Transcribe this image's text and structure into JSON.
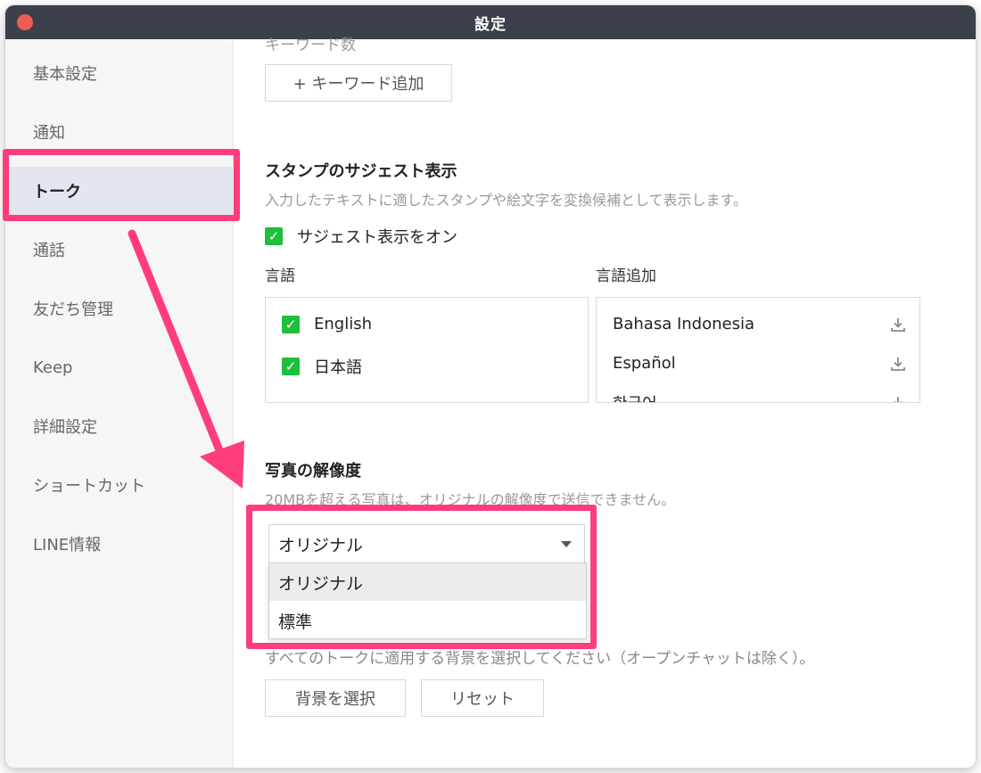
{
  "window": {
    "title": "設定"
  },
  "sidebar": {
    "items": [
      {
        "label": "基本設定"
      },
      {
        "label": "通知"
      },
      {
        "label": "トーク"
      },
      {
        "label": "通話"
      },
      {
        "label": "友だち管理"
      },
      {
        "label": "Keep"
      },
      {
        "label": "詳細設定"
      },
      {
        "label": "ショートカット"
      },
      {
        "label": "LINE情報"
      }
    ],
    "active_index": 2
  },
  "keyword": {
    "count_text_partial": "キーワード数",
    "add_button": "+ キーワード追加"
  },
  "sticker_suggest": {
    "title": "スタンプのサジェスト表示",
    "description": "入力したテキストに適したスタンプや絵文字を変換候補として表示します。",
    "toggle_label": "サジェスト表示をオン",
    "toggle_checked": true,
    "languages_label": "言語",
    "languages": [
      {
        "name": "English",
        "checked": true
      },
      {
        "name": "日本語",
        "checked": true
      }
    ],
    "add_languages_label": "言語追加",
    "available_languages": [
      "Bahasa Indonesia",
      "Español",
      "한국어"
    ]
  },
  "photo_resolution": {
    "title": "写真の解像度",
    "description": "20MBを超える写真は、オリジナルの解像度で送信できません。",
    "selected": "オリジナル",
    "options": [
      "オリジナル",
      "標準"
    ]
  },
  "background": {
    "description": "すべてのトークに適用する背景を選択してください（オープンチャットは除く）。",
    "select_button": "背景を選択",
    "reset_button": "リセット"
  },
  "colors": {
    "titlebar": "#3b404a",
    "accent_green": "#1dbf3b",
    "highlight_pink": "#ff3d7a",
    "close_button": "#ee5c55"
  }
}
